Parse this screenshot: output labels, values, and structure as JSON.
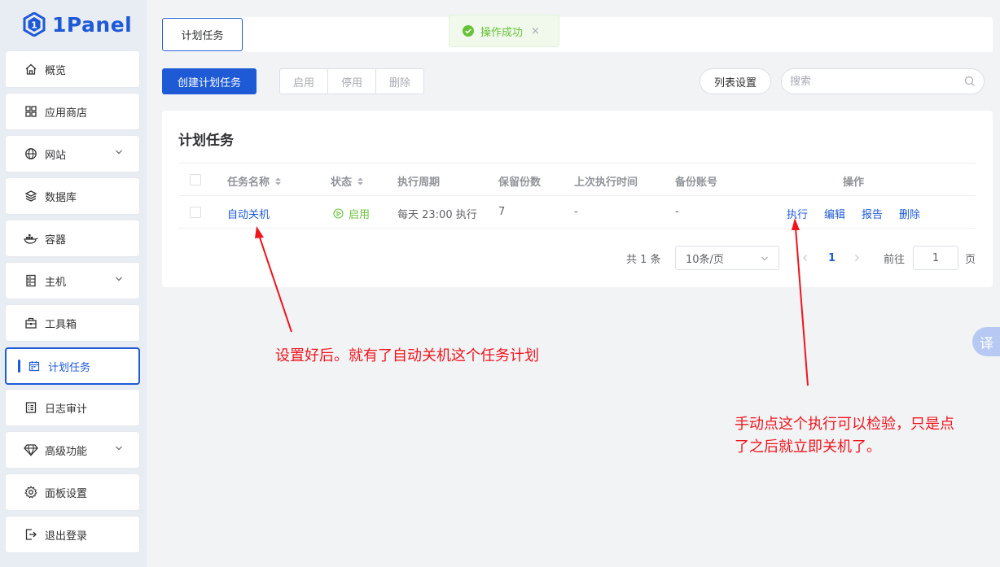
{
  "brand": {
    "name": "1Panel"
  },
  "sidebar": {
    "items": [
      {
        "label": "概览",
        "icon": "home-icon",
        "has_chevron": false
      },
      {
        "label": "应用商店",
        "icon": "grid-icon",
        "has_chevron": false
      },
      {
        "label": "网站",
        "icon": "globe-icon",
        "has_chevron": true
      },
      {
        "label": "数据库",
        "icon": "layers-icon",
        "has_chevron": false
      },
      {
        "label": "容器",
        "icon": "docker-icon",
        "has_chevron": false
      },
      {
        "label": "主机",
        "icon": "server-icon",
        "has_chevron": true
      },
      {
        "label": "工具箱",
        "icon": "toolbox-icon",
        "has_chevron": false
      },
      {
        "label": "计划任务",
        "icon": "calendar-icon",
        "has_chevron": false,
        "active": true
      },
      {
        "label": "日志审计",
        "icon": "log-icon",
        "has_chevron": false
      },
      {
        "label": "高级功能",
        "icon": "diamond-icon",
        "has_chevron": true
      },
      {
        "label": "面板设置",
        "icon": "gear-icon",
        "has_chevron": false
      },
      {
        "label": "退出登录",
        "icon": "logout-icon",
        "has_chevron": false
      }
    ]
  },
  "tabs": {
    "active": "计划任务"
  },
  "toast": {
    "message": "操作成功",
    "close": "×"
  },
  "toolbar": {
    "create_label": "创建计划任务",
    "enable_label": "启用",
    "disable_label": "停用",
    "delete_label": "删除",
    "list_settings_label": "列表设置",
    "search_placeholder": "搜索"
  },
  "card": {
    "title": "计划任务"
  },
  "table": {
    "columns": [
      "任务名称",
      "状态",
      "执行周期",
      "保留份数",
      "上次执行时间",
      "备份账号",
      "操作"
    ],
    "rows": [
      {
        "name": "自动关机",
        "status": "启用",
        "cycle": "每天 23:00 执行",
        "retain": "7",
        "last_run": "-",
        "backup_account": "-",
        "actions": [
          "执行",
          "编辑",
          "报告",
          "删除"
        ]
      }
    ]
  },
  "pagination": {
    "total": "共 1 条",
    "page_size": "10条/页",
    "current_page": "1",
    "goto_prefix": "前往",
    "goto_value": "1",
    "goto_suffix": "页"
  },
  "annotations": {
    "left_note": "设置好后。就有了自动关机这个任务计划",
    "right_note_line1": "手动点这个执行可以检验，只是点",
    "right_note_line2": "了之后就立即关机了。"
  },
  "translate_widget": {
    "label": "译"
  },
  "colors": {
    "primary": "#1e5ad6",
    "success": "#67c23a",
    "annotation": "#f0151d"
  }
}
